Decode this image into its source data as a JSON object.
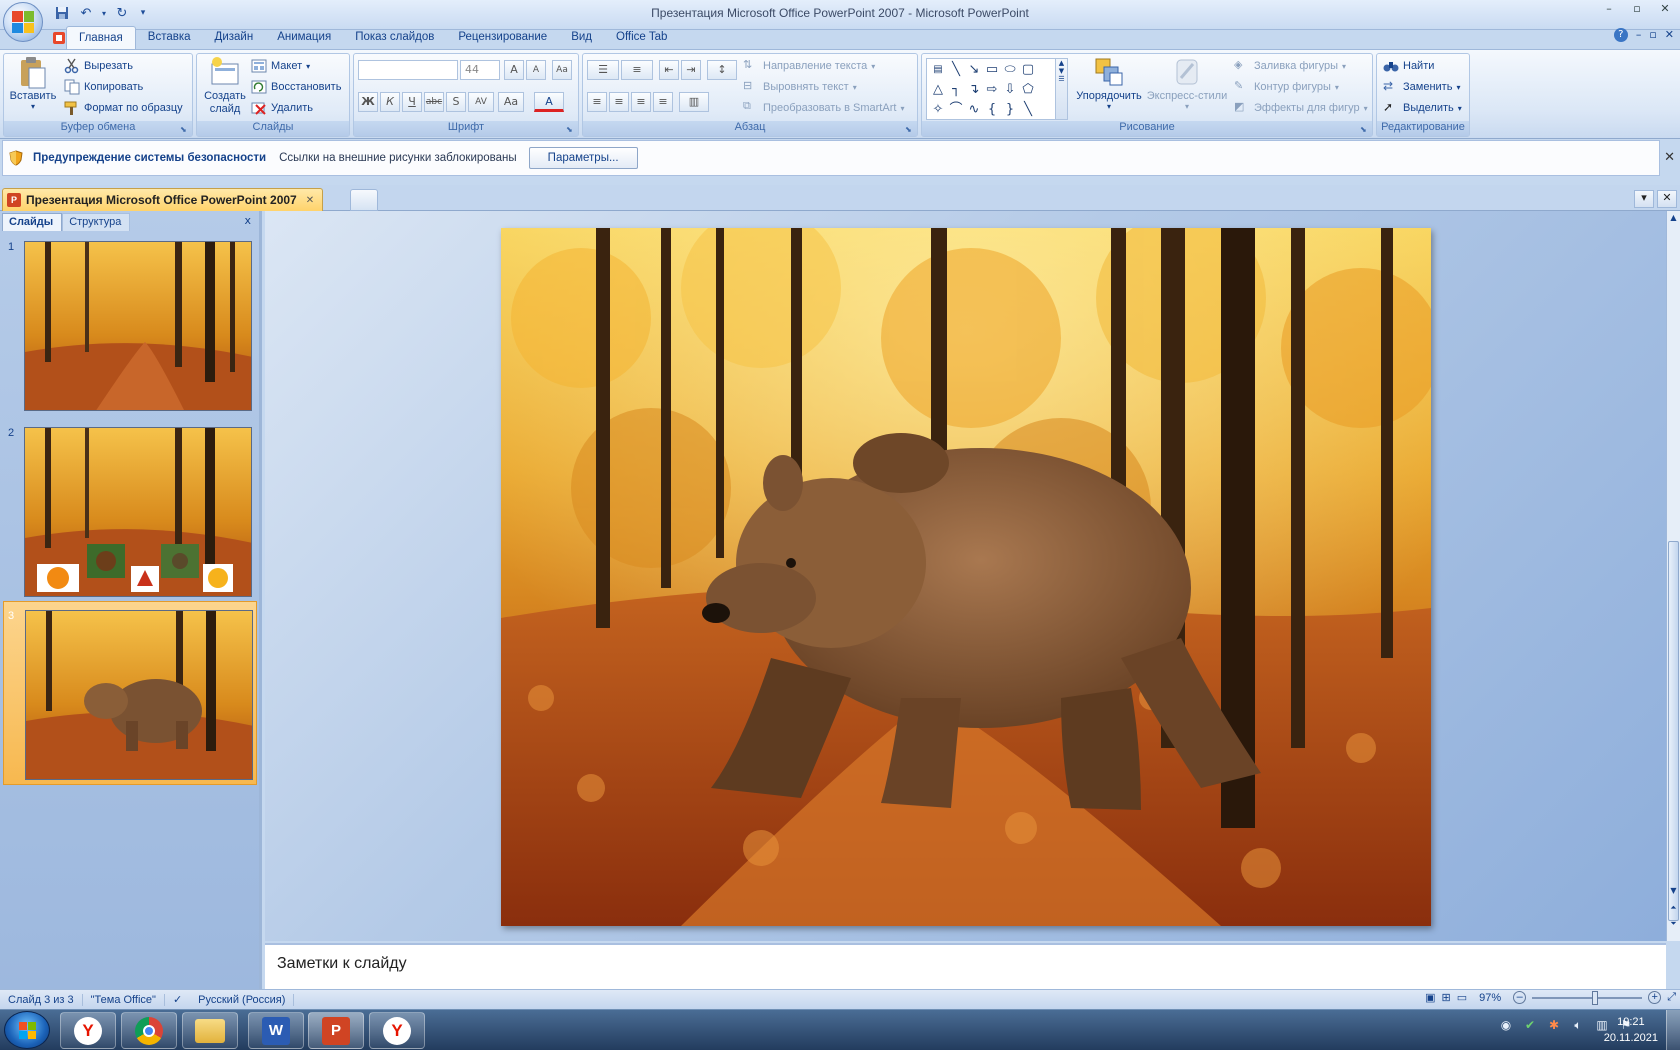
{
  "window": {
    "title": "Презентация Microsoft Office PowerPoint 2007 - Microsoft PowerPoint",
    "minimize": "–",
    "maximize": "▫",
    "close": "✕"
  },
  "qat": {
    "save_icon": "save-icon",
    "undo_icon": "undo-icon",
    "redo_icon": "redo-icon",
    "customize_icon": "qat-dropdown-icon"
  },
  "ribbon_tabs": [
    "Главная",
    "Вставка",
    "Дизайн",
    "Анимация",
    "Показ слайдов",
    "Рецензирование",
    "Вид",
    "Office Tab"
  ],
  "ribbon_help": "?",
  "clipboard": {
    "label": "Буфер обмена",
    "paste": "Вставить",
    "cut": "Вырезать",
    "copy": "Копировать",
    "format_painter": "Формат по образцу"
  },
  "slides_group": {
    "label": "Слайды",
    "new_slide": "Создать слайд",
    "layout": "Макет",
    "reset": "Восстановить",
    "delete": "Удалить"
  },
  "font_group": {
    "label": "Шрифт",
    "font_name": "",
    "font_size": "44",
    "grow": "A",
    "shrink": "A",
    "clear": "Aa",
    "bold": "Ж",
    "italic": "К",
    "underline": "Ч",
    "strike": "abc",
    "shadow": "S",
    "spacing": "AV",
    "case": "Aa",
    "color": "A"
  },
  "paragraph_group": {
    "label": "Абзац",
    "text_direction": "Направление текста",
    "align_text": "Выровнять текст",
    "smartart": "Преобразовать в SmartArt"
  },
  "drawing_group": {
    "label": "Рисование",
    "arrange": "Упорядочить",
    "quick_styles": "Экспресс-стили",
    "shape_fill": "Заливка фигуры",
    "shape_outline": "Контур фигуры",
    "shape_effects": "Эффекты для фигур"
  },
  "editing_group": {
    "label": "Редактирование",
    "find": "Найти",
    "replace": "Заменить",
    "select": "Выделить"
  },
  "security_bar": {
    "title": "Предупреждение системы безопасности",
    "message": "Ссылки на внешние рисунки заблокированы",
    "options_button": "Параметры...",
    "close": "✕"
  },
  "doc_tab": {
    "label": "Презентация Microsoft Office PowerPoint 2007",
    "close": "✕"
  },
  "slide_panel": {
    "tab_slides": "Слайды",
    "tab_outline": "Структура",
    "close": "x",
    "slides": [
      {
        "number": "1",
        "selected": false
      },
      {
        "number": "2",
        "selected": false
      },
      {
        "number": "3",
        "selected": true
      }
    ]
  },
  "notes": {
    "placeholder": "Заметки к слайду"
  },
  "status": {
    "slide_info": "Слайд 3 из 3",
    "theme": "\"Тема Office\"",
    "language": "Русский (Россия)",
    "zoom": "97%",
    "zoom_level": 0.57
  },
  "taskbar": {
    "apps": [
      "yandex-browser",
      "chrome",
      "file-explorer",
      "word",
      "powerpoint",
      "yandex-browser"
    ],
    "time": "19:21",
    "date": "20.11.2021"
  },
  "colors": {
    "accent": "#15428b",
    "ribbon": "#dbe7f6",
    "selected_slide": "#f7b84f",
    "taskbar": "#233c5e"
  }
}
